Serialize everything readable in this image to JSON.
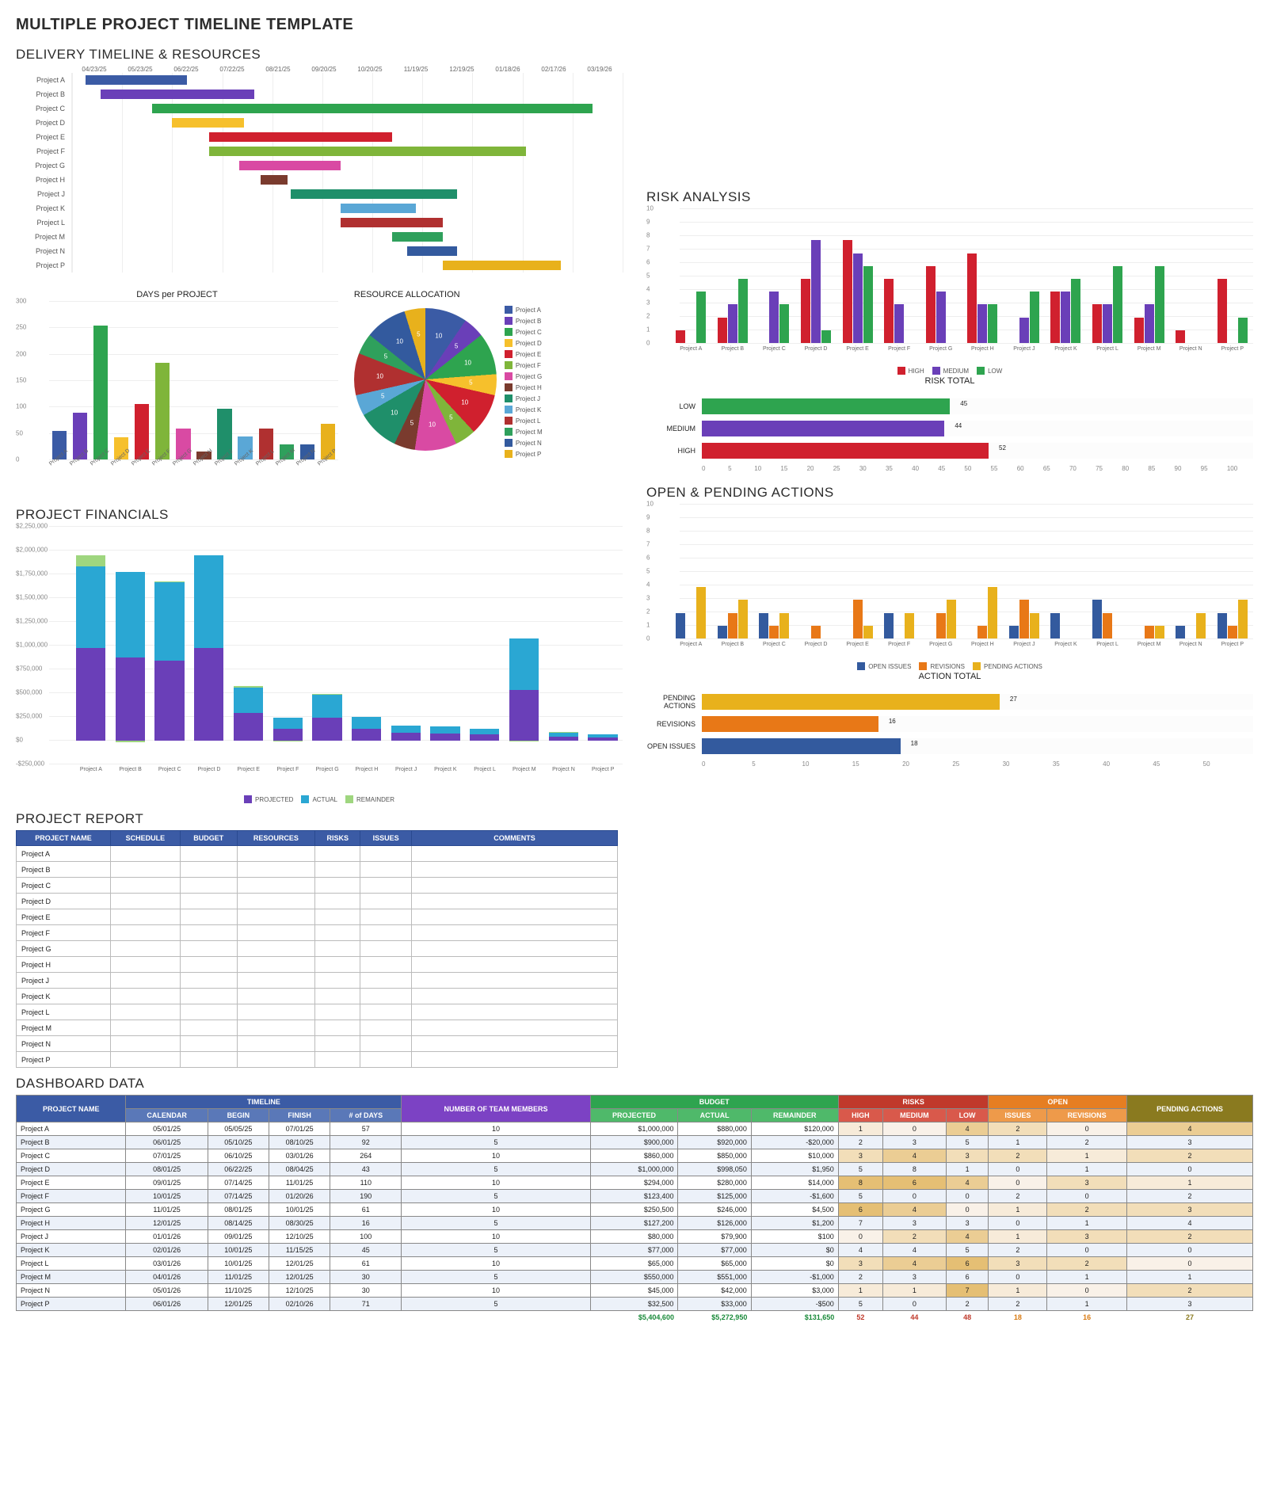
{
  "page_title": "MULTIPLE PROJECT TIMELINE TEMPLATE",
  "sections": {
    "timeline": "DELIVERY TIMELINE & RESOURCES",
    "days_per_project": "DAYS per PROJECT",
    "resource_alloc": "RESOURCE ALLOCATION",
    "risk": "RISK ANALYSIS",
    "risk_total": "RISK TOTAL",
    "open_pending": "OPEN & PENDING ACTIONS",
    "action_total": "ACTION TOTAL",
    "financials": "PROJECT FINANCIALS",
    "report": "PROJECT REPORT",
    "dashboard": "DASHBOARD DATA"
  },
  "projects": [
    "Project A",
    "Project B",
    "Project C",
    "Project D",
    "Project E",
    "Project F",
    "Project G",
    "Project H",
    "Project J",
    "Project K",
    "Project L",
    "Project M",
    "Project N",
    "Project P"
  ],
  "proj_colors": [
    "#3b5ba5",
    "#6a3fb8",
    "#2ea44f",
    "#f6c02c",
    "#d0202e",
    "#7fb53a",
    "#d94aa3",
    "#7a3b2e",
    "#1f8f6a",
    "#5aa7d6",
    "#b03030",
    "#2fa05c",
    "#335a9e",
    "#e8b11c"
  ],
  "chart_data": {
    "gantt": {
      "type": "bar",
      "title": "DELIVERY TIMELINE & RESOURCES",
      "date_ticks": [
        "04/23/25",
        "05/23/25",
        "06/22/25",
        "07/22/25",
        "08/21/25",
        "09/20/25",
        "10/20/25",
        "11/19/25",
        "12/19/25",
        "01/18/26",
        "02/17/26",
        "03/19/26"
      ],
      "bars": [
        {
          "name": "Project A",
          "start": "05/01/25",
          "end": "07/01/25"
        },
        {
          "name": "Project B",
          "start": "05/10/25",
          "end": "08/10/25"
        },
        {
          "name": "Project C",
          "start": "06/10/25",
          "end": "03/01/26"
        },
        {
          "name": "Project D",
          "start": "06/22/25",
          "end": "08/04/25"
        },
        {
          "name": "Project E",
          "start": "07/14/25",
          "end": "11/01/25"
        },
        {
          "name": "Project F",
          "start": "07/14/25",
          "end": "01/20/26"
        },
        {
          "name": "Project G",
          "start": "08/01/25",
          "end": "10/01/25"
        },
        {
          "name": "Project H",
          "start": "08/14/25",
          "end": "08/30/25"
        },
        {
          "name": "Project J",
          "start": "09/01/25",
          "end": "12/10/25"
        },
        {
          "name": "Project K",
          "start": "10/01/25",
          "end": "11/15/25"
        },
        {
          "name": "Project L",
          "start": "10/01/25",
          "end": "12/01/25"
        },
        {
          "name": "Project M",
          "start": "11/01/25",
          "end": "12/01/25"
        },
        {
          "name": "Project N",
          "start": "11/10/25",
          "end": "12/10/25"
        },
        {
          "name": "Project P",
          "start": "12/01/25",
          "end": "02/10/26"
        }
      ]
    },
    "days_per_project": {
      "type": "bar",
      "ylim": [
        0,
        300
      ],
      "yticks": [
        0,
        50,
        100,
        150,
        200,
        250,
        300
      ],
      "categories": [
        "Project A",
        "Project B",
        "Project C",
        "Project D",
        "Project E",
        "Project F",
        "Project G",
        "Project H",
        "Project J",
        "Project K",
        "Project L",
        "Project M",
        "Project N",
        "Project P"
      ],
      "values": [
        57,
        92,
        264,
        43,
        110,
        190,
        61,
        16,
        100,
        45,
        61,
        30,
        30,
        71
      ]
    },
    "resource_allocation": {
      "type": "pie",
      "labels": [
        "Project A",
        "Project B",
        "Project C",
        "Project D",
        "Project E",
        "Project F",
        "Project G",
        "Project H",
        "Project J",
        "Project K",
        "Project L",
        "Project M",
        "Project N",
        "Project P"
      ],
      "values": [
        10,
        5,
        10,
        5,
        10,
        5,
        10,
        5,
        10,
        5,
        10,
        5,
        10,
        5
      ]
    },
    "risk_analysis": {
      "type": "bar",
      "ylim": [
        0,
        10
      ],
      "yticks": [
        0,
        1,
        2,
        3,
        4,
        5,
        6,
        7,
        8,
        9,
        10
      ],
      "categories": [
        "Project A",
        "Project B",
        "Project C",
        "Project D",
        "Project E",
        "Project F",
        "Project G",
        "Project H",
        "Project J",
        "Project K",
        "Project L",
        "Project M",
        "Project N",
        "Project P"
      ],
      "series": [
        {
          "name": "HIGH",
          "color": "#d0202e",
          "values": [
            1,
            2,
            0,
            5,
            8,
            5,
            6,
            7,
            0,
            4,
            3,
            2,
            1,
            5
          ]
        },
        {
          "name": "MEDIUM",
          "color": "#6a3fb8",
          "values": [
            0,
            3,
            4,
            8,
            7,
            3,
            4,
            3,
            2,
            4,
            3,
            3,
            0,
            0
          ]
        },
        {
          "name": "LOW",
          "color": "#2ea44f",
          "values": [
            4,
            5,
            3,
            1,
            6,
            0,
            0,
            3,
            4,
            5,
            6,
            6,
            0,
            2
          ]
        }
      ]
    },
    "risk_total": {
      "type": "bar",
      "orientation": "h",
      "xlim": [
        0,
        100
      ],
      "xticks": [
        0,
        5,
        10,
        15,
        20,
        25,
        30,
        35,
        40,
        45,
        50,
        55,
        60,
        65,
        70,
        75,
        80,
        85,
        90,
        95,
        100
      ],
      "categories": [
        "LOW",
        "MEDIUM",
        "HIGH"
      ],
      "values": [
        45,
        44,
        52
      ],
      "colors": [
        "#2ea44f",
        "#6a3fb8",
        "#d0202e"
      ]
    },
    "open_pending": {
      "type": "bar",
      "ylim": [
        0,
        10
      ],
      "yticks": [
        0,
        1,
        2,
        3,
        4,
        5,
        6,
        7,
        8,
        9,
        10
      ],
      "categories": [
        "Project A",
        "Project B",
        "Project C",
        "Project D",
        "Project E",
        "Project F",
        "Project G",
        "Project H",
        "Project J",
        "Project K",
        "Project L",
        "Project M",
        "Project N",
        "Project P"
      ],
      "series": [
        {
          "name": "OPEN ISSUES",
          "color": "#335a9e",
          "values": [
            2,
            1,
            2,
            0,
            0,
            2,
            0,
            0,
            1,
            2,
            3,
            0,
            1,
            2
          ]
        },
        {
          "name": "REVISIONS",
          "color": "#e87817",
          "values": [
            0,
            2,
            1,
            1,
            3,
            0,
            2,
            1,
            3,
            0,
            2,
            1,
            0,
            1
          ]
        },
        {
          "name": "PENDING ACTIONS",
          "color": "#e8b11c",
          "values": [
            4,
            3,
            2,
            0,
            1,
            2,
            3,
            4,
            2,
            0,
            0,
            1,
            2,
            3
          ]
        }
      ]
    },
    "action_total": {
      "type": "bar",
      "orientation": "h",
      "xlim": [
        0,
        50
      ],
      "xticks": [
        0,
        5,
        10,
        15,
        20,
        25,
        30,
        35,
        40,
        45,
        50
      ],
      "categories": [
        "PENDING ACTIONS",
        "REVISIONS",
        "OPEN ISSUES"
      ],
      "values": [
        27,
        16,
        18
      ],
      "colors": [
        "#e8b11c",
        "#e87817",
        "#335a9e"
      ]
    },
    "financials": {
      "type": "bar",
      "stacked": true,
      "ylim": [
        -250000,
        2250000
      ],
      "yticks": [
        "-$250,000",
        "$0",
        "$250,000",
        "$500,000",
        "$750,000",
        "$1,000,000",
        "$1,250,000",
        "$1,500,000",
        "$1,750,000",
        "$2,000,000",
        "$2,250,000"
      ],
      "categories": [
        "Project A",
        "Project B",
        "Project C",
        "Project D",
        "Project E",
        "Project F",
        "Project G",
        "Project H",
        "Project J",
        "Project K",
        "Project L",
        "Project M",
        "Project N",
        "Project P"
      ],
      "series": [
        {
          "name": "PROJECTED",
          "color": "#6a3fb8",
          "values": [
            1000000,
            900000,
            860000,
            1000000,
            294000,
            123400,
            250500,
            127200,
            80000,
            77000,
            65000,
            550000,
            45000,
            32500
          ]
        },
        {
          "name": "ACTUAL",
          "color": "#2aa7d3",
          "values": [
            880000,
            920000,
            850000,
            998050,
            280000,
            125000,
            246000,
            126000,
            79900,
            77000,
            65000,
            551000,
            42000,
            33000
          ]
        },
        {
          "name": "REMAINDER",
          "color": "#9fd67f",
          "values": [
            120000,
            -20000,
            10000,
            1950,
            14000,
            -1600,
            4500,
            1200,
            100,
            0,
            0,
            -1000,
            3000,
            -500
          ]
        }
      ]
    }
  },
  "report_headers": [
    "PROJECT NAME",
    "SCHEDULE",
    "BUDGET",
    "RESOURCES",
    "RISKS",
    "ISSUES",
    "COMMENTS"
  ],
  "dashboard": {
    "group_headers": [
      "PROJECT NAME",
      "TIMELINE",
      "NUMBER OF TEAM MEMBERS",
      "BUDGET",
      "RISKS",
      "OPEN",
      "PENDING ACTIONS"
    ],
    "sub_headers": [
      "CALENDAR",
      "BEGIN",
      "FINISH",
      "# of DAYS",
      "PROJECTED",
      "ACTUAL",
      "REMAINDER",
      "HIGH",
      "MEDIUM",
      "LOW",
      "ISSUES",
      "REVISIONS"
    ],
    "rows": [
      {
        "name": "Project A",
        "cal": "05/01/25",
        "begin": "05/05/25",
        "finish": "07/01/25",
        "days": 57,
        "team": 10,
        "proj": "$1,000,000",
        "act": "$880,000",
        "rem": "$120,000",
        "h": 1,
        "m": 0,
        "l": 4,
        "iss": 2,
        "rev": 0,
        "pa": 4
      },
      {
        "name": "Project B",
        "cal": "06/01/25",
        "begin": "05/10/25",
        "finish": "08/10/25",
        "days": 92,
        "team": 5,
        "proj": "$900,000",
        "act": "$920,000",
        "rem": "-$20,000",
        "h": 2,
        "m": 3,
        "l": 5,
        "iss": 1,
        "rev": 2,
        "pa": 3
      },
      {
        "name": "Project C",
        "cal": "07/01/25",
        "begin": "06/10/25",
        "finish": "03/01/26",
        "days": 264,
        "team": 10,
        "proj": "$860,000",
        "act": "$850,000",
        "rem": "$10,000",
        "h": 3,
        "m": 4,
        "l": 3,
        "iss": 2,
        "rev": 1,
        "pa": 2
      },
      {
        "name": "Project D",
        "cal": "08/01/25",
        "begin": "06/22/25",
        "finish": "08/04/25",
        "days": 43,
        "team": 5,
        "proj": "$1,000,000",
        "act": "$998,050",
        "rem": "$1,950",
        "h": 5,
        "m": 8,
        "l": 1,
        "iss": 0,
        "rev": 1,
        "pa": 0
      },
      {
        "name": "Project E",
        "cal": "09/01/25",
        "begin": "07/14/25",
        "finish": "11/01/25",
        "days": 110,
        "team": 10,
        "proj": "$294,000",
        "act": "$280,000",
        "rem": "$14,000",
        "h": 8,
        "m": 6,
        "l": 4,
        "iss": 0,
        "rev": 3,
        "pa": 1
      },
      {
        "name": "Project F",
        "cal": "10/01/25",
        "begin": "07/14/25",
        "finish": "01/20/26",
        "days": 190,
        "team": 5,
        "proj": "$123,400",
        "act": "$125,000",
        "rem": "-$1,600",
        "h": 5,
        "m": 0,
        "l": 0,
        "iss": 2,
        "rev": 0,
        "pa": 2
      },
      {
        "name": "Project G",
        "cal": "11/01/25",
        "begin": "08/01/25",
        "finish": "10/01/25",
        "days": 61,
        "team": 10,
        "proj": "$250,500",
        "act": "$246,000",
        "rem": "$4,500",
        "h": 6,
        "m": 4,
        "l": 0,
        "iss": 1,
        "rev": 2,
        "pa": 3
      },
      {
        "name": "Project H",
        "cal": "12/01/25",
        "begin": "08/14/25",
        "finish": "08/30/25",
        "days": 16,
        "team": 5,
        "proj": "$127,200",
        "act": "$126,000",
        "rem": "$1,200",
        "h": 7,
        "m": 3,
        "l": 3,
        "iss": 0,
        "rev": 1,
        "pa": 4
      },
      {
        "name": "Project J",
        "cal": "01/01/26",
        "begin": "09/01/25",
        "finish": "12/10/25",
        "days": 100,
        "team": 10,
        "proj": "$80,000",
        "act": "$79,900",
        "rem": "$100",
        "h": 0,
        "m": 2,
        "l": 4,
        "iss": 1,
        "rev": 3,
        "pa": 2
      },
      {
        "name": "Project K",
        "cal": "02/01/26",
        "begin": "10/01/25",
        "finish": "11/15/25",
        "days": 45,
        "team": 5,
        "proj": "$77,000",
        "act": "$77,000",
        "rem": "$0",
        "h": 4,
        "m": 4,
        "l": 5,
        "iss": 2,
        "rev": 0,
        "pa": 0
      },
      {
        "name": "Project L",
        "cal": "03/01/26",
        "begin": "10/01/25",
        "finish": "12/01/25",
        "days": 61,
        "team": 10,
        "proj": "$65,000",
        "act": "$65,000",
        "rem": "$0",
        "h": 3,
        "m": 4,
        "l": 6,
        "iss": 3,
        "rev": 2,
        "pa": 0
      },
      {
        "name": "Project M",
        "cal": "04/01/26",
        "begin": "11/01/25",
        "finish": "12/01/25",
        "days": 30,
        "team": 5,
        "proj": "$550,000",
        "act": "$551,000",
        "rem": "-$1,000",
        "h": 2,
        "m": 3,
        "l": 6,
        "iss": 0,
        "rev": 1,
        "pa": 1
      },
      {
        "name": "Project N",
        "cal": "05/01/26",
        "begin": "11/10/25",
        "finish": "12/10/25",
        "days": 30,
        "team": 10,
        "proj": "$45,000",
        "act": "$42,000",
        "rem": "$3,000",
        "h": 1,
        "m": 1,
        "l": 7,
        "iss": 1,
        "rev": 0,
        "pa": 2
      },
      {
        "name": "Project P",
        "cal": "06/01/26",
        "begin": "12/01/25",
        "finish": "02/10/26",
        "days": 71,
        "team": 5,
        "proj": "$32,500",
        "act": "$33,000",
        "rem": "-$500",
        "h": 5,
        "m": 0,
        "l": 2,
        "iss": 2,
        "rev": 1,
        "pa": 3
      }
    ],
    "totals": {
      "proj": "$5,404,600",
      "act": "$5,272,950",
      "rem": "$131,650",
      "h": 52,
      "m": 44,
      "l": 48,
      "iss": 18,
      "rev": 16,
      "pa": 27
    }
  }
}
